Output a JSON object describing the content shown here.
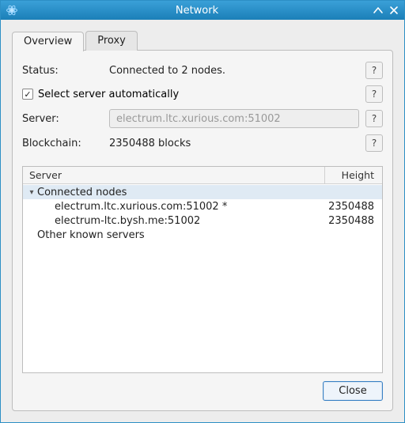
{
  "window": {
    "title": "Network",
    "app_icon_name": "electrum-app-icon"
  },
  "tabs": [
    {
      "label": "Overview",
      "active": true
    },
    {
      "label": "Proxy",
      "active": false
    }
  ],
  "overview": {
    "status_label": "Status:",
    "status_value": "Connected to 2 nodes.",
    "auto_select_checked": true,
    "auto_select_label": "Select server automatically",
    "server_label": "Server:",
    "server_placeholder": "electrum.ltc.xurious.com:51002",
    "blockchain_label": "Blockchain:",
    "blockchain_value": "2350488 blocks",
    "help_glyph": "?"
  },
  "tree": {
    "columns": {
      "server": "Server",
      "height": "Height"
    },
    "groups": [
      {
        "label": "Connected nodes",
        "expanded": true,
        "selected": true,
        "items": [
          {
            "server": "electrum.ltc.xurious.com:51002 *",
            "height": "2350488"
          },
          {
            "server": "electrum-ltc.bysh.me:51002",
            "height": "2350488"
          }
        ]
      },
      {
        "label": "Other known servers",
        "expanded": false,
        "selected": false,
        "items": []
      }
    ]
  },
  "buttons": {
    "close": "Close"
  }
}
